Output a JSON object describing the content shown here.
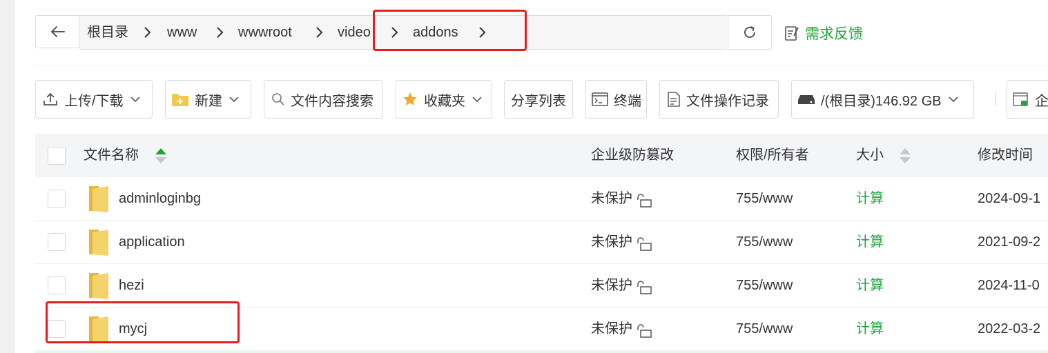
{
  "path": {
    "crumbs": [
      "根目录",
      "www",
      "wwwroot",
      "video",
      "addons"
    ]
  },
  "feedback_label": "需求反馈",
  "toolbar": {
    "upload_download": "上传/下载",
    "new": "新建",
    "content_search": "文件内容搜索",
    "favorites": "收藏夹",
    "share_list": "分享列表",
    "terminal": "终端",
    "file_log": "文件操作记录",
    "disk": "/(根目录)146.92 GB",
    "enterprise": "企"
  },
  "table": {
    "headers": {
      "name": "文件名称",
      "tamper": "企业级防篡改",
      "perm": "权限/所有者",
      "size": "大小",
      "mtime": "修改时间"
    },
    "rows": [
      {
        "name": "adminloginbg",
        "tamper": "未保护",
        "perm": "755/www",
        "size": "计算",
        "mtime": "2024-09-1"
      },
      {
        "name": "application",
        "tamper": "未保护",
        "perm": "755/www",
        "size": "计算",
        "mtime": "2021-09-2"
      },
      {
        "name": "hezi",
        "tamper": "未保护",
        "perm": "755/www",
        "size": "计算",
        "mtime": "2024-11-0"
      },
      {
        "name": "mycj",
        "tamper": "未保护",
        "perm": "755/www",
        "size": "计算",
        "mtime": "2022-03-2"
      }
    ]
  },
  "colors": {
    "accent": "#20a53a",
    "highlight": "#e81c1c",
    "folder": "#f5d36b"
  }
}
